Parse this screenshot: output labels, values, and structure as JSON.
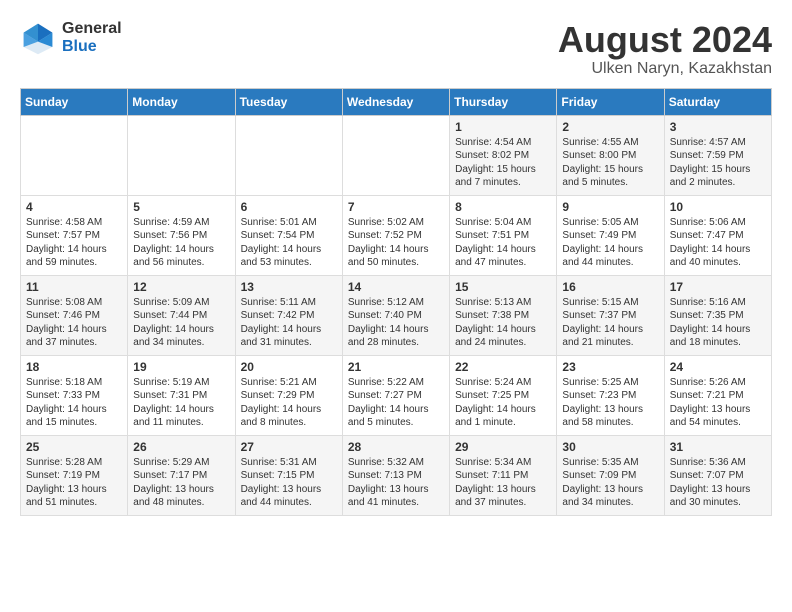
{
  "logo": {
    "general": "General",
    "blue": "Blue"
  },
  "title": "August 2024",
  "location": "Ulken Naryn, Kazakhstan",
  "headers": [
    "Sunday",
    "Monday",
    "Tuesday",
    "Wednesday",
    "Thursday",
    "Friday",
    "Saturday"
  ],
  "weeks": [
    [
      {
        "day": "",
        "sunrise": "",
        "sunset": "",
        "daylight": ""
      },
      {
        "day": "",
        "sunrise": "",
        "sunset": "",
        "daylight": ""
      },
      {
        "day": "",
        "sunrise": "",
        "sunset": "",
        "daylight": ""
      },
      {
        "day": "",
        "sunrise": "",
        "sunset": "",
        "daylight": ""
      },
      {
        "day": "1",
        "sunrise": "Sunrise: 4:54 AM",
        "sunset": "Sunset: 8:02 PM",
        "daylight": "Daylight: 15 hours and 7 minutes."
      },
      {
        "day": "2",
        "sunrise": "Sunrise: 4:55 AM",
        "sunset": "Sunset: 8:00 PM",
        "daylight": "Daylight: 15 hours and 5 minutes."
      },
      {
        "day": "3",
        "sunrise": "Sunrise: 4:57 AM",
        "sunset": "Sunset: 7:59 PM",
        "daylight": "Daylight: 15 hours and 2 minutes."
      }
    ],
    [
      {
        "day": "4",
        "sunrise": "Sunrise: 4:58 AM",
        "sunset": "Sunset: 7:57 PM",
        "daylight": "Daylight: 14 hours and 59 minutes."
      },
      {
        "day": "5",
        "sunrise": "Sunrise: 4:59 AM",
        "sunset": "Sunset: 7:56 PM",
        "daylight": "Daylight: 14 hours and 56 minutes."
      },
      {
        "day": "6",
        "sunrise": "Sunrise: 5:01 AM",
        "sunset": "Sunset: 7:54 PM",
        "daylight": "Daylight: 14 hours and 53 minutes."
      },
      {
        "day": "7",
        "sunrise": "Sunrise: 5:02 AM",
        "sunset": "Sunset: 7:52 PM",
        "daylight": "Daylight: 14 hours and 50 minutes."
      },
      {
        "day": "8",
        "sunrise": "Sunrise: 5:04 AM",
        "sunset": "Sunset: 7:51 PM",
        "daylight": "Daylight: 14 hours and 47 minutes."
      },
      {
        "day": "9",
        "sunrise": "Sunrise: 5:05 AM",
        "sunset": "Sunset: 7:49 PM",
        "daylight": "Daylight: 14 hours and 44 minutes."
      },
      {
        "day": "10",
        "sunrise": "Sunrise: 5:06 AM",
        "sunset": "Sunset: 7:47 PM",
        "daylight": "Daylight: 14 hours and 40 minutes."
      }
    ],
    [
      {
        "day": "11",
        "sunrise": "Sunrise: 5:08 AM",
        "sunset": "Sunset: 7:46 PM",
        "daylight": "Daylight: 14 hours and 37 minutes."
      },
      {
        "day": "12",
        "sunrise": "Sunrise: 5:09 AM",
        "sunset": "Sunset: 7:44 PM",
        "daylight": "Daylight: 14 hours and 34 minutes."
      },
      {
        "day": "13",
        "sunrise": "Sunrise: 5:11 AM",
        "sunset": "Sunset: 7:42 PM",
        "daylight": "Daylight: 14 hours and 31 minutes."
      },
      {
        "day": "14",
        "sunrise": "Sunrise: 5:12 AM",
        "sunset": "Sunset: 7:40 PM",
        "daylight": "Daylight: 14 hours and 28 minutes."
      },
      {
        "day": "15",
        "sunrise": "Sunrise: 5:13 AM",
        "sunset": "Sunset: 7:38 PM",
        "daylight": "Daylight: 14 hours and 24 minutes."
      },
      {
        "day": "16",
        "sunrise": "Sunrise: 5:15 AM",
        "sunset": "Sunset: 7:37 PM",
        "daylight": "Daylight: 14 hours and 21 minutes."
      },
      {
        "day": "17",
        "sunrise": "Sunrise: 5:16 AM",
        "sunset": "Sunset: 7:35 PM",
        "daylight": "Daylight: 14 hours and 18 minutes."
      }
    ],
    [
      {
        "day": "18",
        "sunrise": "Sunrise: 5:18 AM",
        "sunset": "Sunset: 7:33 PM",
        "daylight": "Daylight: 14 hours and 15 minutes."
      },
      {
        "day": "19",
        "sunrise": "Sunrise: 5:19 AM",
        "sunset": "Sunset: 7:31 PM",
        "daylight": "Daylight: 14 hours and 11 minutes."
      },
      {
        "day": "20",
        "sunrise": "Sunrise: 5:21 AM",
        "sunset": "Sunset: 7:29 PM",
        "daylight": "Daylight: 14 hours and 8 minutes."
      },
      {
        "day": "21",
        "sunrise": "Sunrise: 5:22 AM",
        "sunset": "Sunset: 7:27 PM",
        "daylight": "Daylight: 14 hours and 5 minutes."
      },
      {
        "day": "22",
        "sunrise": "Sunrise: 5:24 AM",
        "sunset": "Sunset: 7:25 PM",
        "daylight": "Daylight: 14 hours and 1 minute."
      },
      {
        "day": "23",
        "sunrise": "Sunrise: 5:25 AM",
        "sunset": "Sunset: 7:23 PM",
        "daylight": "Daylight: 13 hours and 58 minutes."
      },
      {
        "day": "24",
        "sunrise": "Sunrise: 5:26 AM",
        "sunset": "Sunset: 7:21 PM",
        "daylight": "Daylight: 13 hours and 54 minutes."
      }
    ],
    [
      {
        "day": "25",
        "sunrise": "Sunrise: 5:28 AM",
        "sunset": "Sunset: 7:19 PM",
        "daylight": "Daylight: 13 hours and 51 minutes."
      },
      {
        "day": "26",
        "sunrise": "Sunrise: 5:29 AM",
        "sunset": "Sunset: 7:17 PM",
        "daylight": "Daylight: 13 hours and 48 minutes."
      },
      {
        "day": "27",
        "sunrise": "Sunrise: 5:31 AM",
        "sunset": "Sunset: 7:15 PM",
        "daylight": "Daylight: 13 hours and 44 minutes."
      },
      {
        "day": "28",
        "sunrise": "Sunrise: 5:32 AM",
        "sunset": "Sunset: 7:13 PM",
        "daylight": "Daylight: 13 hours and 41 minutes."
      },
      {
        "day": "29",
        "sunrise": "Sunrise: 5:34 AM",
        "sunset": "Sunset: 7:11 PM",
        "daylight": "Daylight: 13 hours and 37 minutes."
      },
      {
        "day": "30",
        "sunrise": "Sunrise: 5:35 AM",
        "sunset": "Sunset: 7:09 PM",
        "daylight": "Daylight: 13 hours and 34 minutes."
      },
      {
        "day": "31",
        "sunrise": "Sunrise: 5:36 AM",
        "sunset": "Sunset: 7:07 PM",
        "daylight": "Daylight: 13 hours and 30 minutes."
      }
    ]
  ]
}
